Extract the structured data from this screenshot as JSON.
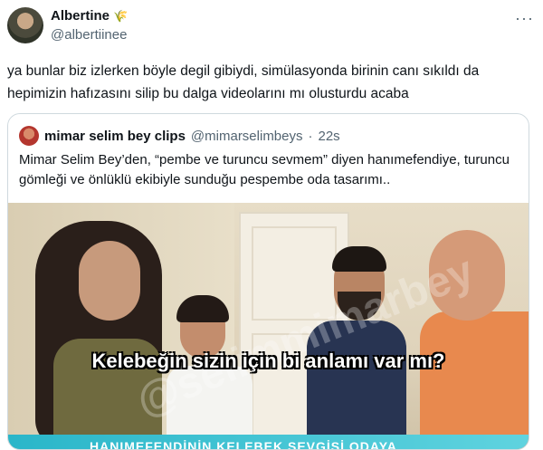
{
  "author": {
    "name": "Albertine",
    "handle": "@albertiinee",
    "name_emoji": "🌾"
  },
  "more_menu": "···",
  "tweet": {
    "text": "ya bunlar biz izlerken böyle degil gibiydi, simülasyonda birinin canı sıkıldı da hepimizin hafızasını silip bu dalga videolarını mı olusturdu acaba"
  },
  "quote": {
    "name": "mimar selim bey clips",
    "handle": "@mimarselimbeys",
    "separator": "·",
    "time": "22s",
    "text": "Mimar Selim Bey’den, “pembe ve turuncu sevmem” diyen hanımefendiye, turuncu gömleği ve önlüklü ekibiyle sunduğu pespembe oda tasarımı..",
    "video": {
      "caption": "Kelebeğin sizin için bi anlamı var mı?",
      "watermark": "@selimmimarbey",
      "banner": "HANIMEFENDİNİN KELEBEK SEVGİSİ ODAYA"
    }
  },
  "colors": {
    "text": "#0f1419",
    "secondary": "#536471",
    "border": "#cfd9de"
  }
}
